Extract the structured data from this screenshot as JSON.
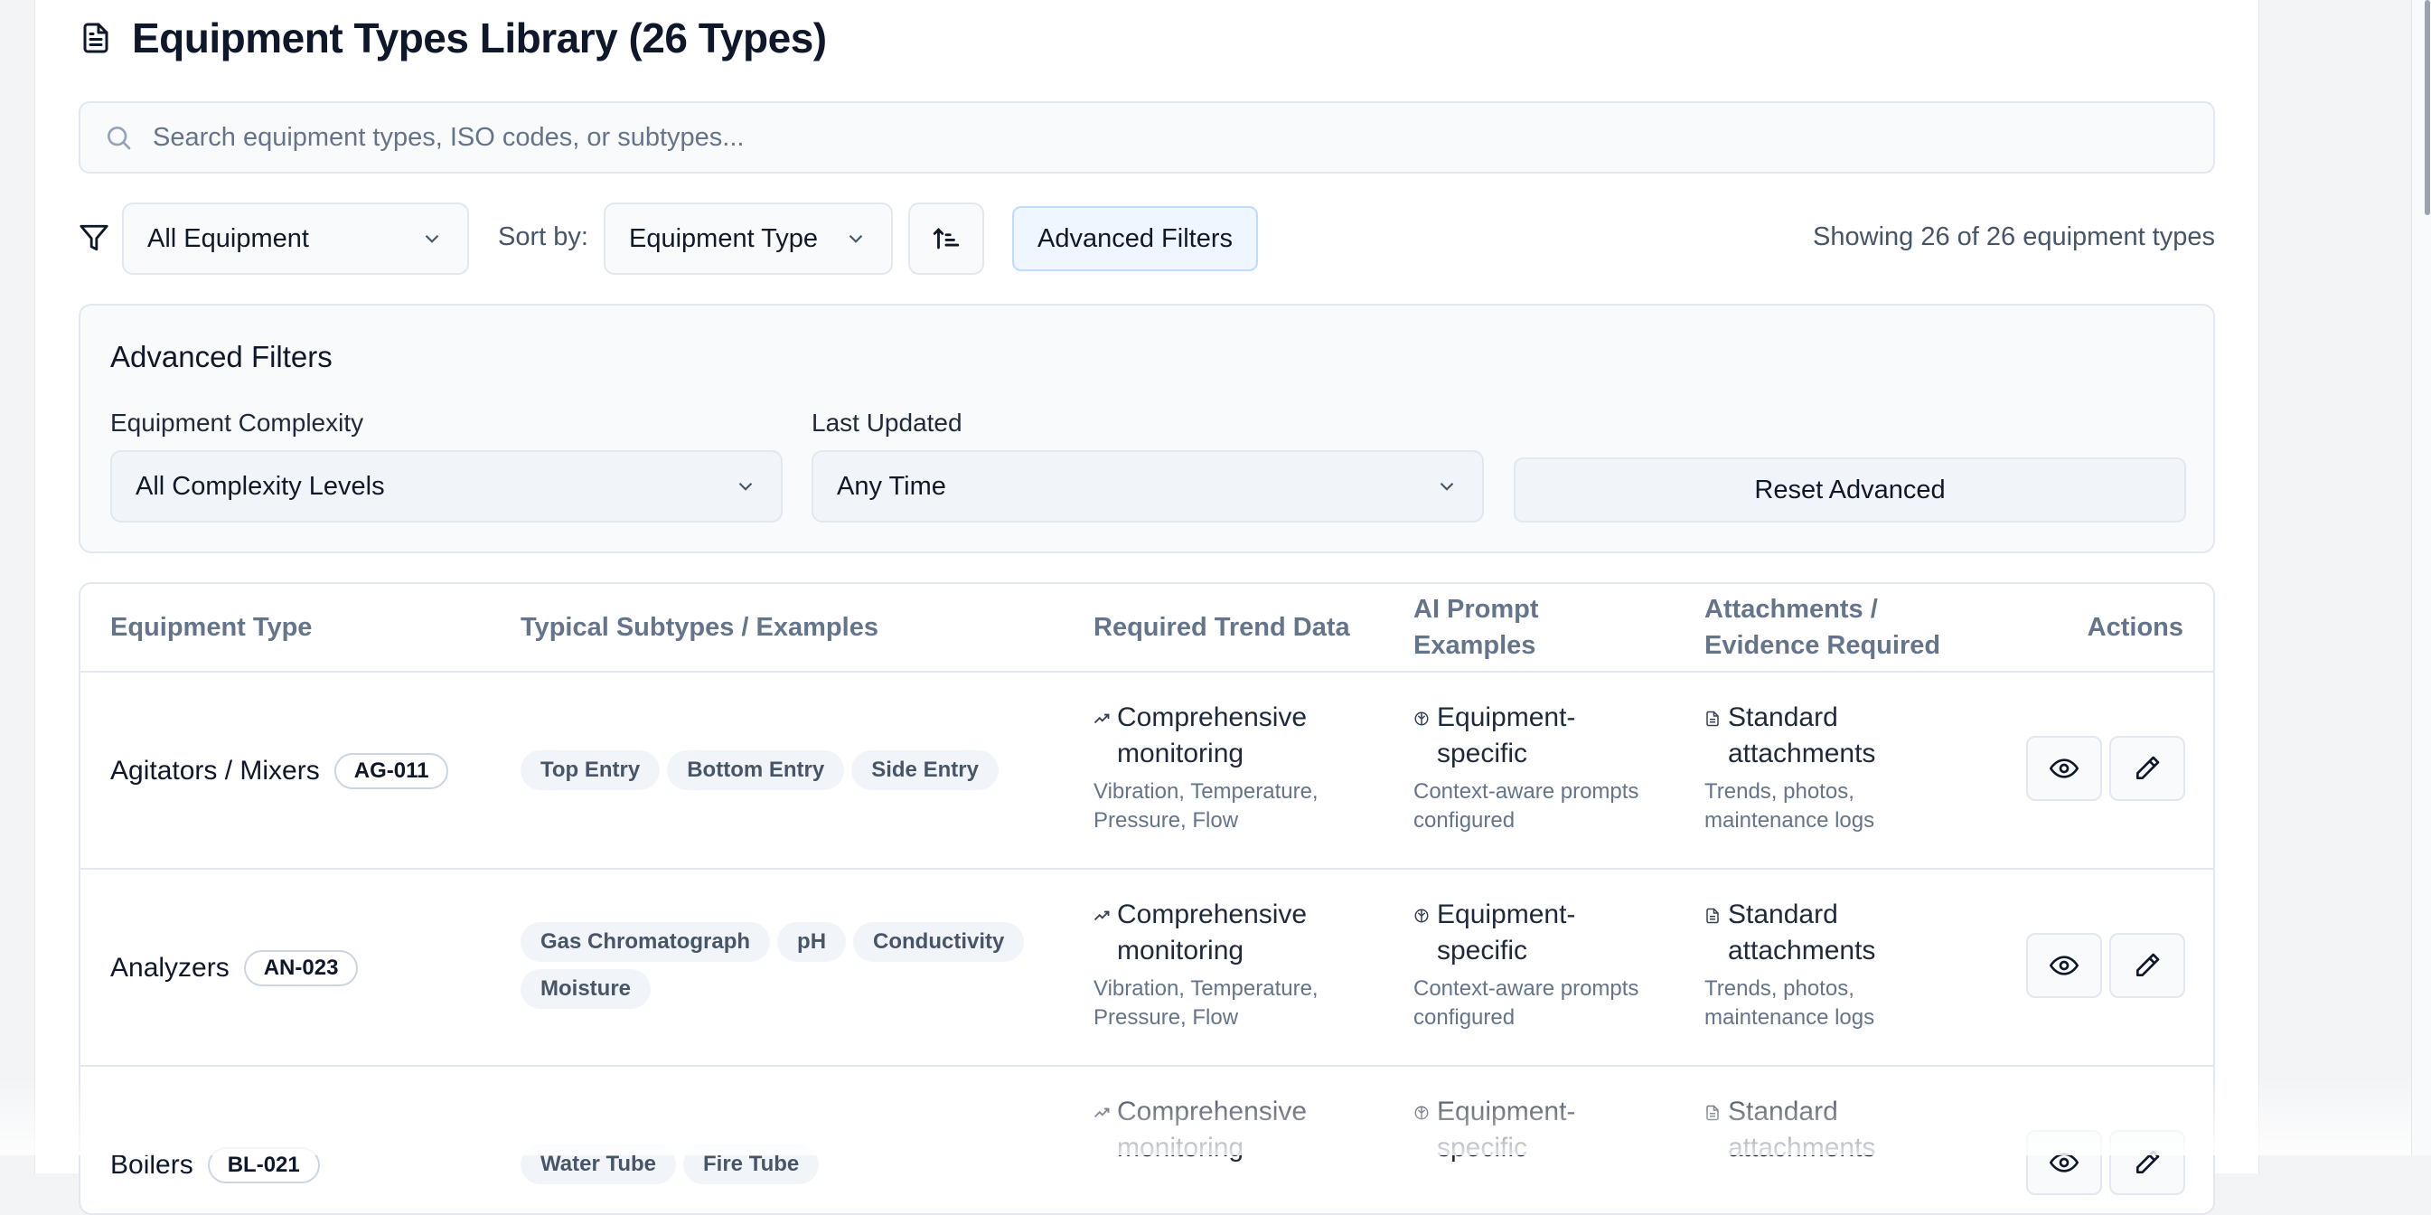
{
  "header": {
    "title": "Equipment Types Library (26 Types)"
  },
  "search": {
    "placeholder": "Search equipment types, ISO codes, or subtypes..."
  },
  "toolbar": {
    "category_value": "All Equipment",
    "sort_label": "Sort by:",
    "sort_value": "Equipment Type",
    "advanced_button": "Advanced Filters",
    "showing_text": "Showing 26 of 26 equipment types"
  },
  "advanced": {
    "title": "Advanced Filters",
    "complexity_label": "Equipment Complexity",
    "complexity_value": "All Complexity Levels",
    "updated_label": "Last Updated",
    "updated_value": "Any Time",
    "reset_button": "Reset Advanced"
  },
  "table": {
    "headers": {
      "type": "Equipment Type",
      "subtypes": "Typical Subtypes / Examples",
      "trend": "Required Trend Data",
      "ai": "AI Prompt Examples",
      "attach": "Attachments / Evidence Required",
      "actions": "Actions"
    },
    "rows": [
      {
        "name": "Agitators / Mixers",
        "code": "AG-011",
        "subtypes": [
          "Top Entry",
          "Bottom Entry",
          "Side Entry"
        ],
        "trend_title": "Comprehensive monitoring",
        "trend_sub": "Vibration, Temperature, Pressure, Flow",
        "ai_title": "Equipment-specific",
        "ai_sub": "Context-aware prompts configured",
        "attach_title": "Standard attachments",
        "attach_sub": "Trends, photos, maintenance logs"
      },
      {
        "name": "Analyzers",
        "code": "AN-023",
        "subtypes": [
          "Gas Chromatograph",
          "pH",
          "Conductivity",
          "Moisture"
        ],
        "trend_title": "Comprehensive monitoring",
        "trend_sub": "Vibration, Temperature, Pressure, Flow",
        "ai_title": "Equipment-specific",
        "ai_sub": "Context-aware prompts configured",
        "attach_title": "Standard attachments",
        "attach_sub": "Trends, photos, maintenance logs"
      },
      {
        "name": "Boilers",
        "code": "BL-021",
        "subtypes": [
          "Water Tube",
          "Fire Tube"
        ],
        "trend_title": "Comprehensive monitoring",
        "trend_sub": "",
        "ai_title": "Equipment-specific",
        "ai_sub": "",
        "attach_title": "Standard attachments",
        "attach_sub": ""
      }
    ]
  }
}
